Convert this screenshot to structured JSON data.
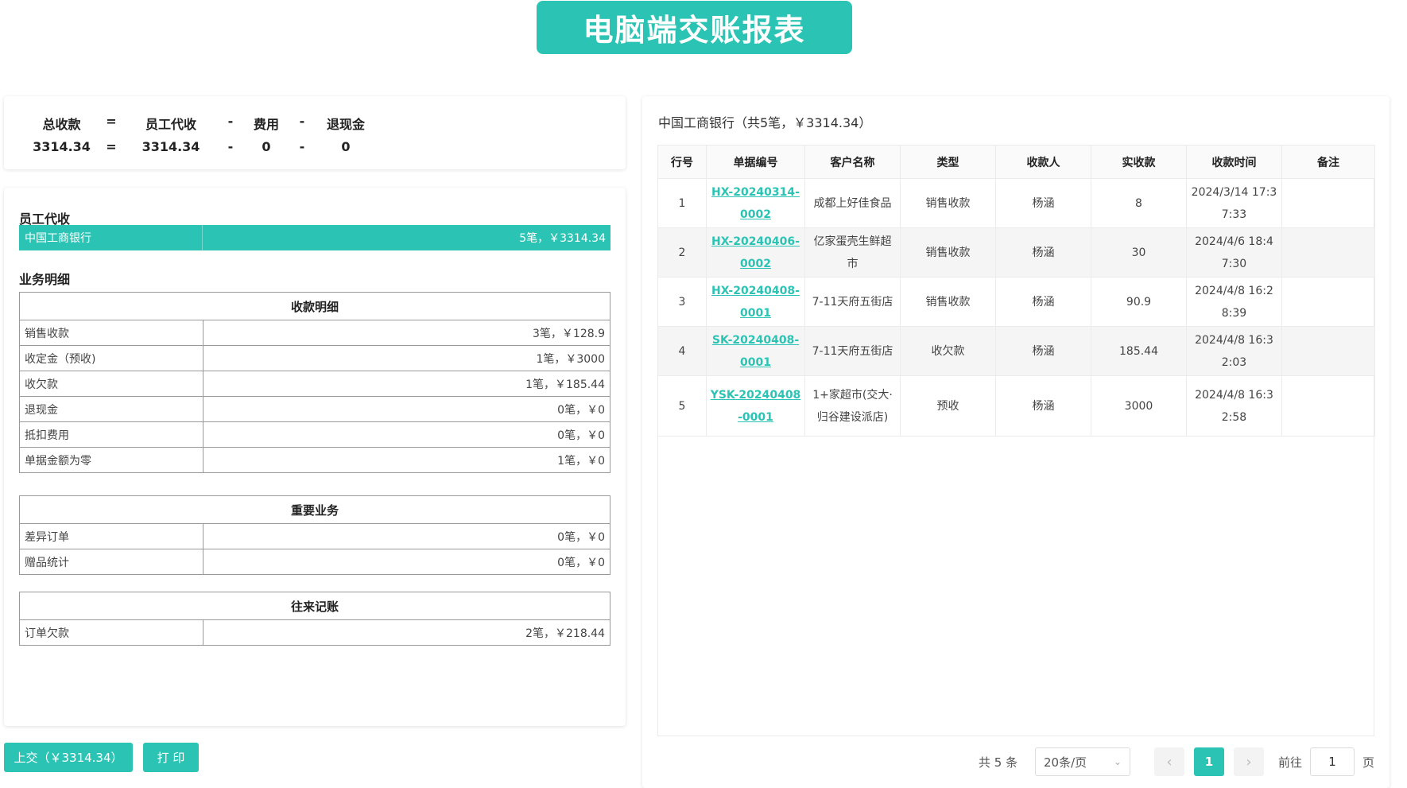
{
  "title": "电脑端交账报表",
  "summary": {
    "headers": [
      "总收款",
      "=",
      "员工代收",
      "-",
      "费用",
      "-",
      "退现金"
    ],
    "values": [
      "3314.34",
      "=",
      "3314.34",
      "-",
      "0",
      "-",
      "0"
    ]
  },
  "left": {
    "staff_collect_title": "员工代收",
    "bank": {
      "name": "中国工商银行",
      "value": "5笔，￥3314.34"
    },
    "business_title": "业务明细",
    "tables": [
      {
        "header": "收款明细",
        "rows": [
          {
            "label": "销售收款",
            "value": "3笔，￥128.9"
          },
          {
            "label": "收定金（预收)",
            "value": "1笔，￥3000"
          },
          {
            "label": "收欠款",
            "value": "1笔，￥185.44"
          },
          {
            "label": "退现金",
            "value": "0笔，￥0"
          },
          {
            "label": "抵扣费用",
            "value": "0笔，￥0"
          },
          {
            "label": "单据金额为零",
            "value": "1笔，￥0"
          }
        ]
      },
      {
        "header": "重要业务",
        "rows": [
          {
            "label": "差异订单",
            "value": "0笔，￥0"
          },
          {
            "label": "赠品统计",
            "value": "0笔，￥0"
          }
        ]
      },
      {
        "header": "往来记账",
        "rows": [
          {
            "label": "订单欠款",
            "value": "2笔，￥218.44"
          }
        ]
      }
    ],
    "submit_label": "上交（￥3314.34）",
    "print_label": "打 印"
  },
  "right": {
    "heading": "中国工商银行（共5笔，￥3314.34）",
    "columns": [
      "行号",
      "单据编号",
      "客户名称",
      "类型",
      "收款人",
      "实收款",
      "收款时间",
      "备注"
    ],
    "rows": [
      {
        "no": "1",
        "doc": "HX-20240314-0002",
        "customer": "成都上好佳食品",
        "type": "销售收款",
        "payee": "杨涵",
        "amount": "8",
        "time": "2024/3/14 17:37:33",
        "note": ""
      },
      {
        "no": "2",
        "doc": "HX-20240406-0002",
        "customer": "亿家蛋壳生鲜超市",
        "type": "销售收款",
        "payee": "杨涵",
        "amount": "30",
        "time": "2024/4/6 18:47:30",
        "note": ""
      },
      {
        "no": "3",
        "doc": "HX-20240408-0001",
        "customer": "7-11天府五街店",
        "type": "销售收款",
        "payee": "杨涵",
        "amount": "90.9",
        "time": "2024/4/8 16:28:39",
        "note": ""
      },
      {
        "no": "4",
        "doc": "SK-20240408-0001",
        "customer": "7-11天府五街店",
        "type": "收欠款",
        "payee": "杨涵",
        "amount": "185.44",
        "time": "2024/4/8 16:32:03",
        "note": ""
      },
      {
        "no": "5",
        "doc": "YSK-20240408-0001",
        "customer": "1+家超市(交大·归谷建设派店)",
        "type": "预收",
        "payee": "杨涵",
        "amount": "3000",
        "time": "2024/4/8 16:32:58",
        "note": ""
      }
    ],
    "pagination": {
      "total": "共 5 条",
      "page_size": "20条/页",
      "current_page": "1",
      "goto_label": "前往",
      "goto_value": "1",
      "page_suffix": "页"
    }
  }
}
